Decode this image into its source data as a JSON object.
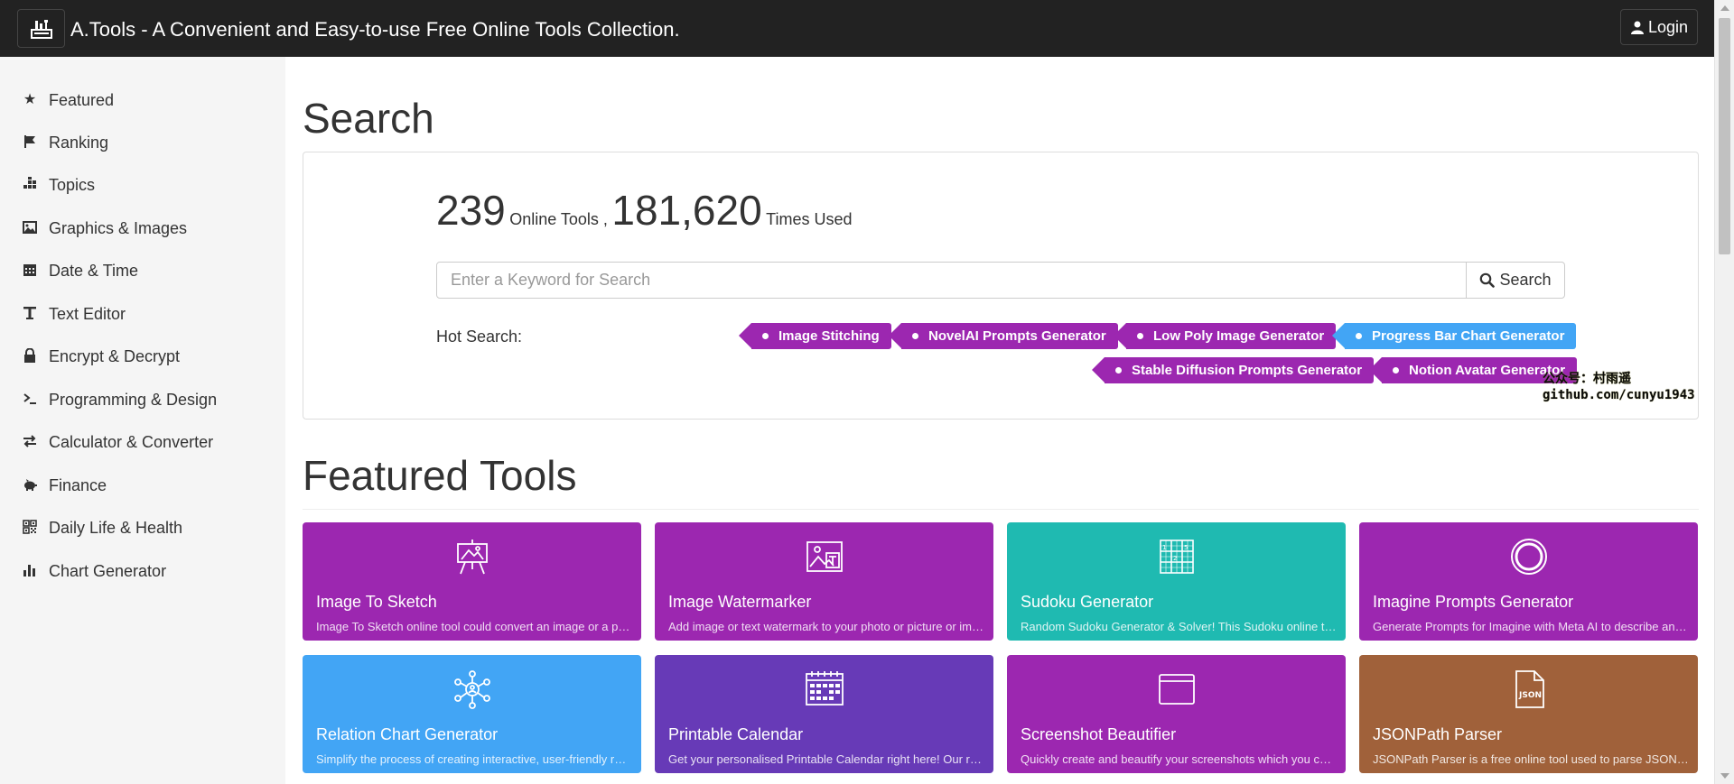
{
  "header": {
    "title": "A.Tools - A Convenient and Easy-to-use Free Online Tools Collection.",
    "logo_icon": "toolbox-logo-icon",
    "login_label": "Login"
  },
  "sidebar": {
    "items": [
      {
        "label": "Featured",
        "icon": "star-icon"
      },
      {
        "label": "Ranking",
        "icon": "flag-icon"
      },
      {
        "label": "Topics",
        "icon": "grid-dots-icon"
      },
      {
        "label": "Graphics & Images",
        "icon": "image-icon"
      },
      {
        "label": "Date & Time",
        "icon": "calendar-icon"
      },
      {
        "label": "Text Editor",
        "icon": "text-icon"
      },
      {
        "label": "Encrypt & Decrypt",
        "icon": "lock-icon"
      },
      {
        "label": "Programming & Design",
        "icon": "terminal-icon"
      },
      {
        "label": "Calculator & Converter",
        "icon": "swap-arrows-icon"
      },
      {
        "label": "Finance",
        "icon": "piggy-bank-icon"
      },
      {
        "label": "Daily Life & Health",
        "icon": "qr-code-icon"
      },
      {
        "label": "Chart Generator",
        "icon": "bar-chart-icon"
      }
    ]
  },
  "search_section": {
    "heading": "Search",
    "tools_count": "239",
    "tools_label": "Online Tools ,",
    "times_count": "181,620",
    "times_label": "Times Used",
    "placeholder": "Enter a Keyword for Search",
    "button_label": "Search",
    "hot_label": "Hot Search:",
    "hot_tags": [
      {
        "label": "Image Stitching",
        "color": "#9c27b0"
      },
      {
        "label": "NovelAI Prompts Generator",
        "color": "#9c27b0"
      },
      {
        "label": "Low Poly Image Generator",
        "color": "#9c27b0"
      },
      {
        "label": "Progress Bar Chart Generator",
        "color": "#42a5f5"
      },
      {
        "label": "Stable Diffusion Prompts Generator",
        "color": "#9c27b0"
      },
      {
        "label": "Notion Avatar Generator",
        "color": "#9c27b0"
      }
    ]
  },
  "watermark": {
    "line1": "公众号：村雨遥",
    "line2": "github.com/cunyu1943"
  },
  "featured": {
    "heading": "Featured Tools",
    "cards": [
      {
        "title": "Image To Sketch",
        "desc": "Image To Sketch online tool could convert an image or a photo to a sketch",
        "color": "#9c27b0",
        "icon": "easel-sketch-icon"
      },
      {
        "title": "Image Watermarker",
        "desc": "Add image or text watermark to your photo or picture or image online",
        "color": "#9c27b0",
        "icon": "image-text-icon"
      },
      {
        "title": "Sudoku Generator",
        "desc": "Random Sudoku Generator & Solver! This Sudoku online tool can generate",
        "color": "#1fbab1",
        "icon": "sudoku-grid-icon"
      },
      {
        "title": "Imagine Prompts Generator",
        "desc": "Generate Prompts for Imagine with Meta AI to describe an image",
        "color": "#9c27b0",
        "icon": "ring-circle-icon"
      },
      {
        "title": "Relation Chart Generator",
        "desc": "Simplify the process of creating interactive, user-friendly relation charts",
        "color": "#42a5f5",
        "icon": "network-nodes-icon"
      },
      {
        "title": "Printable Calendar",
        "desc": "Get your personalised Printable Calendar right here! Our range of calendars",
        "color": "#673ab7",
        "icon": "calendar-grid-icon"
      },
      {
        "title": "Screenshot Beautifier",
        "desc": "Quickly create and beautify your screenshots which you can share anywhere",
        "color": "#9c27b0",
        "icon": "browser-window-icon"
      },
      {
        "title": "JSONPath Parser",
        "desc": "JSONPath Parser is a free online tool used to parse JSON data",
        "color": "#a0613a",
        "icon": "json-file-icon"
      }
    ]
  }
}
